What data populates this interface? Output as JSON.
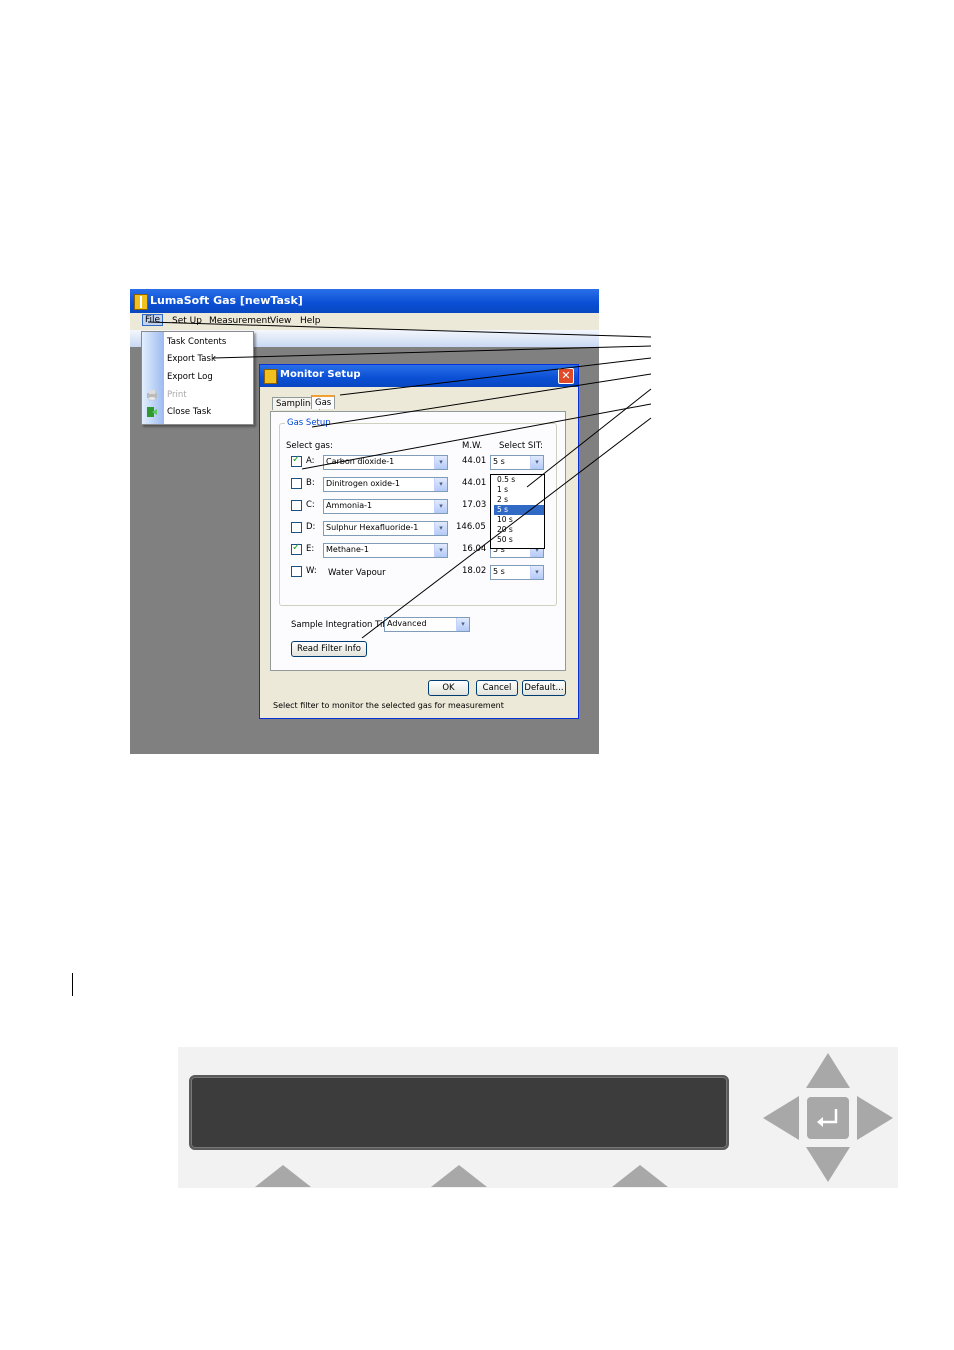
{
  "app": {
    "title": "LumaSoft Gas [newTask]",
    "menu": [
      "File",
      "Set Up",
      "Measurement",
      "View",
      "Help"
    ]
  },
  "file_menu": {
    "items": [
      {
        "label": "Task Contents",
        "enabled": true
      },
      {
        "label": "Export Task",
        "enabled": true
      },
      {
        "label": "Export Log",
        "enabled": true
      },
      {
        "label": "Print",
        "enabled": false
      },
      {
        "label": "Close Task",
        "enabled": true
      }
    ]
  },
  "dialog": {
    "title": "Monitor Setup",
    "close_glyph": "✕",
    "tabs": [
      "Sampling",
      "Gas"
    ],
    "active_tab": "Gas",
    "group_title": "Gas Setup",
    "col_select_gas": "Select gas:",
    "col_mw": "M.W.",
    "col_sit": "Select SIT:",
    "gases": [
      {
        "letter": "A:",
        "name": "Carbon dioxide-1",
        "mw": "44.01",
        "sit": "5 s",
        "checked": true
      },
      {
        "letter": "B:",
        "name": "Dinitrogen oxide-1",
        "mw": "44.01",
        "sit": "5 s",
        "checked": false
      },
      {
        "letter": "C:",
        "name": "Ammonia-1",
        "mw": "17.03",
        "sit": "5 s",
        "checked": false
      },
      {
        "letter": "D:",
        "name": "Sulphur Hexafluoride-1",
        "mw": "146.05",
        "sit": "5 s",
        "checked": false
      },
      {
        "letter": "E:",
        "name": "Methane-1",
        "mw": "16.04",
        "sit": "5 s",
        "checked": true
      },
      {
        "letter": "W:",
        "name": "Water Vapour",
        "mw": "18.02",
        "sit": "5 s",
        "checked": false
      }
    ],
    "sit_options": [
      "0.5 s",
      "1 s",
      "2 s",
      "5 s",
      "10 s",
      "20 s",
      "50 s"
    ],
    "sit_selected": "5 s",
    "sample_integration_label": "Sample Integration Time:",
    "sample_integration_value": "Advanced",
    "read_filter_button": "Read Filter Info",
    "ok_button": "OK",
    "cancel_button": "Cancel",
    "default_button": "Default...",
    "status_text": "Select filter to monitor the selected gas for measurement"
  },
  "icons": {
    "dropdown_arrow": "▾",
    "enter_key": "↵"
  },
  "colors": {
    "title_bar": "#0a4fd4",
    "selection": "#316ac5",
    "check_mark": "#21a121",
    "lcd": "#3c3c3c",
    "panel_keys": "#a8a8a8"
  }
}
